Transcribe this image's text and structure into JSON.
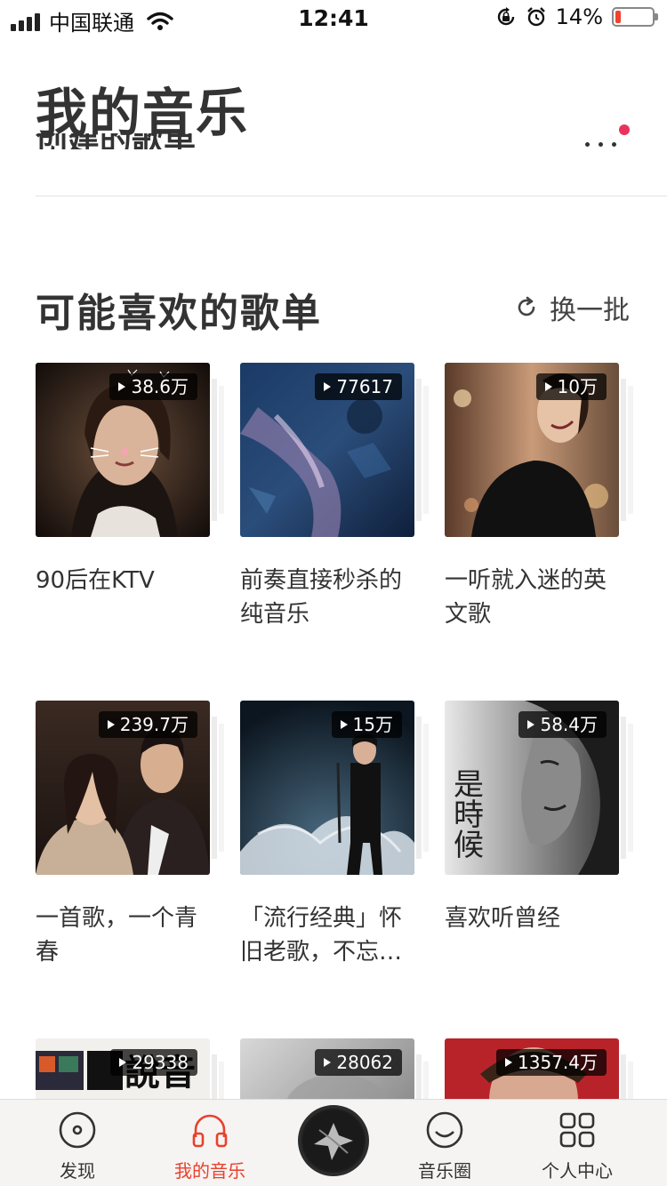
{
  "status_bar": {
    "carrier": "中国联通",
    "time": "12:41",
    "battery_percent": "14%",
    "battery_level": 0.14,
    "battery_color": "#f0422f"
  },
  "header": {
    "title": "我的音乐",
    "more_icon": "more-dots-icon",
    "badge_color": "#e8345c"
  },
  "section": {
    "title": "可能喜欢的歌单",
    "refresh_label": "换一批",
    "refresh_icon": "refresh-icon"
  },
  "playlists": [
    {
      "play_count": "38.6万",
      "title": "90后在KTV"
    },
    {
      "play_count": "77617",
      "title": "前奏直接秒杀的纯音乐"
    },
    {
      "play_count": "10万",
      "title": "一听就入迷的英文歌"
    },
    {
      "play_count": "239.7万",
      "title": "一首歌，一个青春"
    },
    {
      "play_count": "15万",
      "title": "「流行经典」怀旧老歌，不忘…"
    },
    {
      "play_count": "58.4万",
      "title": "喜欢听曾经",
      "cover_text": "是時候"
    },
    {
      "play_count": "29338",
      "title": "",
      "cover_text": "說音"
    },
    {
      "play_count": "28062",
      "title": ""
    },
    {
      "play_count": "1357.4万",
      "title": ""
    }
  ],
  "tab_bar": {
    "tabs": [
      {
        "label": "发现",
        "icon": "disc-icon",
        "active": false
      },
      {
        "label": "我的音乐",
        "icon": "headphones-icon",
        "active": true
      },
      {
        "label": "音乐圈",
        "icon": "smile-face-icon",
        "active": false
      },
      {
        "label": "个人中心",
        "icon": "grid-icon",
        "active": false
      }
    ],
    "active_color": "#e8412b"
  }
}
